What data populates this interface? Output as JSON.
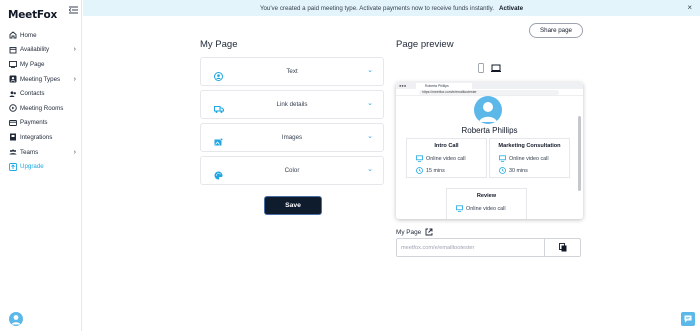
{
  "app": {
    "logo": "MeetFox"
  },
  "banner": {
    "message": "You've created a paid meeting type. Activate payments now to receive funds instantly.",
    "action": "Activate",
    "close": "×"
  },
  "sidebar": {
    "items": [
      {
        "label": "Home",
        "icon": "home-icon",
        "chevron": false
      },
      {
        "label": "Availability",
        "icon": "calendar-icon",
        "chevron": true
      },
      {
        "label": "My Page",
        "icon": "page-icon",
        "chevron": false
      },
      {
        "label": "Meeting Types",
        "icon": "meeting-types-icon",
        "chevron": true
      },
      {
        "label": "Contacts",
        "icon": "contacts-icon",
        "chevron": false
      },
      {
        "label": "Meeting Rooms",
        "icon": "meeting-rooms-icon",
        "chevron": false
      },
      {
        "label": "Payments",
        "icon": "payments-icon",
        "chevron": false
      },
      {
        "label": "Integrations",
        "icon": "integrations-icon",
        "chevron": false
      },
      {
        "label": "Teams",
        "icon": "teams-icon",
        "chevron": true
      },
      {
        "label": "Upgrade",
        "icon": "upgrade-icon",
        "chevron": false
      }
    ]
  },
  "share_button": "Share page",
  "my_page": {
    "title": "My Page",
    "sections": [
      {
        "label": "Text",
        "icon": "person-icon"
      },
      {
        "label": "Link details",
        "icon": "truck-icon"
      },
      {
        "label": "Images",
        "icon": "image-icon"
      },
      {
        "label": "Color",
        "icon": "palette-icon"
      }
    ],
    "save": "Save"
  },
  "preview": {
    "title": "Page preview",
    "tab_title": "Roberta Phillips",
    "url": "https://meetfox.com/e/emailtootester",
    "name": "Roberta Phillips",
    "events": [
      {
        "title": "Intro Call",
        "location": "Online video call",
        "duration": "15 mins"
      },
      {
        "title": "Marketing Consultation",
        "location": "Online video call",
        "duration": "30 mins"
      },
      {
        "title": "Review",
        "location": "Online video call",
        "duration": ""
      }
    ]
  },
  "page_link": {
    "label": "My Page",
    "value": "meetfox.com/e/emailtootester"
  },
  "colors": {
    "accent": "#1ea7e4",
    "save_bg": "#0f1c2e",
    "banner_bg": "#e4f4fb"
  }
}
